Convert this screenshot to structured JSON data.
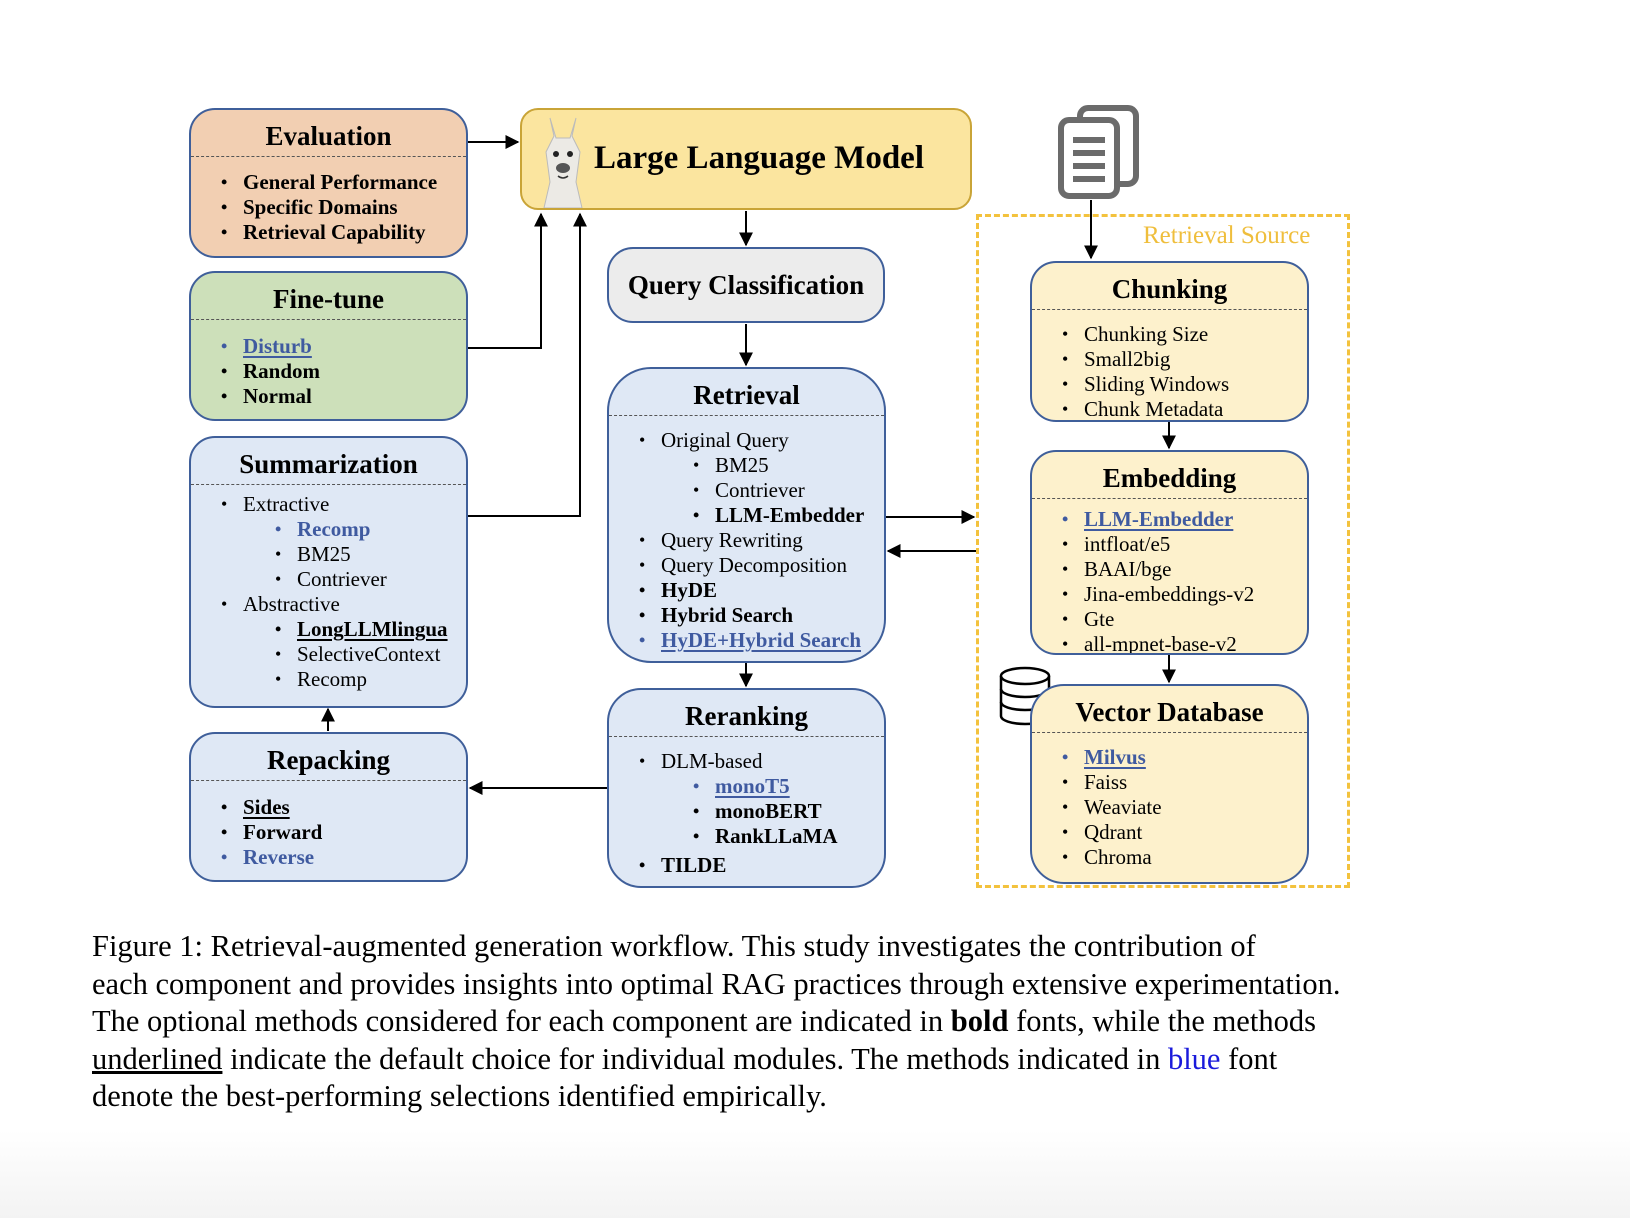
{
  "diagram": {
    "llm": {
      "title": "Large Language Model",
      "icon": "llama-icon"
    },
    "query_classification": {
      "title": "Query Classification"
    },
    "evaluation": {
      "title": "Evaluation",
      "items": [
        "General Performance",
        "Specific Domains",
        "Retrieval Capability"
      ]
    },
    "finetune": {
      "title": "Fine-tune",
      "items": [
        "Disturb",
        "Random",
        "Normal"
      ]
    },
    "summarization": {
      "title": "Summarization",
      "items": [
        "Extractive",
        "Recomp",
        "BM25",
        "Contriever",
        "Abstractive",
        "LongLLMlingua",
        "SelectiveContext",
        "Recomp"
      ]
    },
    "repacking": {
      "title": "Repacking",
      "items": [
        "Sides",
        "Forward",
        "Reverse"
      ]
    },
    "retrieval": {
      "title": "Retrieval",
      "items": [
        "Original Query",
        "BM25",
        "Contriever",
        "LLM-Embedder",
        "Query Rewriting",
        "Query Decomposition",
        "HyDE",
        "Hybrid Search",
        "HyDE+Hybrid Search"
      ]
    },
    "reranking": {
      "title": "Reranking",
      "items": [
        "DLM-based",
        "monoT5",
        "monoBERT",
        "RankLLaMA",
        "TILDE"
      ]
    },
    "retrieval_source": {
      "label": "Retrieval Source",
      "icon": "documents-icon",
      "chunking": {
        "title": "Chunking",
        "items": [
          "Chunking Size",
          "Small2big",
          "Sliding Windows",
          "Chunk Metadata"
        ]
      },
      "embedding": {
        "title": "Embedding",
        "items": [
          "LLM-Embedder",
          "intfloat/e5",
          "BAAI/bge",
          "Jina-embeddings-v2",
          "Gte",
          "all-mpnet-base-v2"
        ]
      },
      "vector_db": {
        "title": "Vector Database",
        "icon": "database-icon",
        "items": [
          "Milvus",
          "Faiss",
          "Weaviate",
          "Qdrant",
          "Chroma"
        ]
      }
    },
    "colors": {
      "border_blue": "#3f5f9a",
      "best_blue": "#3f5aa0",
      "evaluation_fill": "#f2cfb2",
      "finetune_fill": "#cde0ba",
      "module_fill": "#dfe8f5",
      "source_fill": "#fdf1cc",
      "llm_fill": "#fbe59f",
      "source_dash": "#f3c23d"
    }
  },
  "caption": {
    "lines": [
      "Figure 1:   Retrieval-augmented generation workflow.  This study investigates the contribution of",
      "each component and provides insights into optimal RAG practices through extensive experimentation.",
      [
        "The optional methods considered for each component are indicated in ",
        "bold",
        " fonts, while the methods"
      ],
      [
        "underlined",
        " indicate the default choice for individual modules.  The methods indicated in ",
        "blue",
        " font"
      ],
      "denote the best-performing selections identified empirically."
    ]
  }
}
